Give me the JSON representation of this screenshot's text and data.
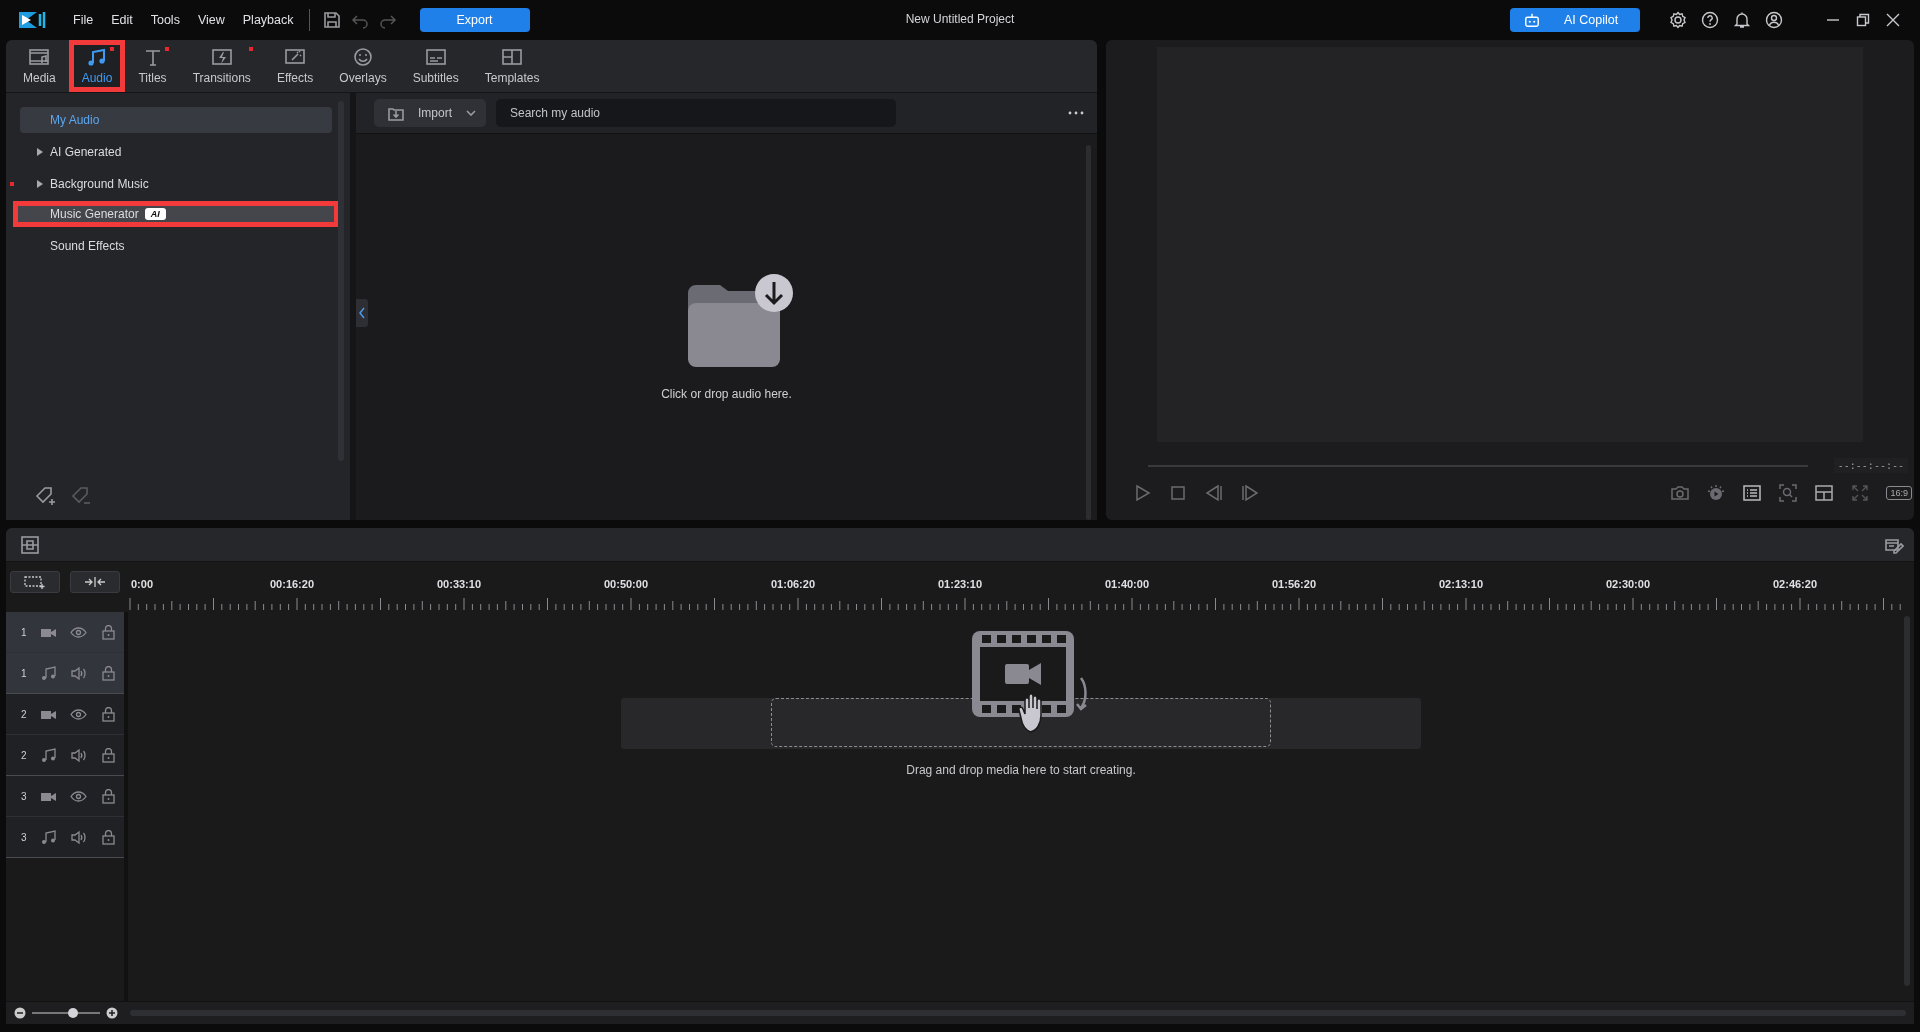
{
  "app": {
    "menu": [
      "File",
      "Edit",
      "Tools",
      "View",
      "Playback"
    ],
    "export": "Export",
    "title": "New Untitled Project",
    "copilot": "AI Copilot"
  },
  "library_tabs": [
    {
      "label": "Media",
      "selected": false,
      "new": false,
      "highlighted": false
    },
    {
      "label": "Audio",
      "selected": true,
      "new": true,
      "highlighted": true
    },
    {
      "label": "Titles",
      "selected": false,
      "new": true,
      "highlighted": false
    },
    {
      "label": "Transitions",
      "selected": false,
      "new": true,
      "highlighted": false
    },
    {
      "label": "Effects",
      "selected": false,
      "new": false,
      "highlighted": false
    },
    {
      "label": "Overlays",
      "selected": false,
      "new": false,
      "highlighted": false
    },
    {
      "label": "Subtitles",
      "selected": false,
      "new": false,
      "highlighted": false
    },
    {
      "label": "Templates",
      "selected": false,
      "new": false,
      "highlighted": false
    }
  ],
  "audio_tree": [
    {
      "label": "My Audio",
      "kind": "leaf",
      "selected": true,
      "new": false,
      "highlighted": false
    },
    {
      "label": "AI Generated",
      "kind": "folder",
      "expanded": false,
      "selected": false,
      "new": false,
      "highlighted": false
    },
    {
      "label": "Background Music",
      "kind": "folder",
      "expanded": false,
      "selected": false,
      "new": true,
      "highlighted": false
    },
    {
      "label": "Music Generator",
      "kind": "leaf",
      "badge": "AI",
      "selected": false,
      "new": false,
      "highlighted": true
    },
    {
      "label": "Sound Effects",
      "kind": "leaf",
      "selected": false,
      "new": false,
      "highlighted": false
    }
  ],
  "import_button": "Import",
  "search": {
    "placeholder": "Search my audio"
  },
  "empty_text": "Click or drop audio here.",
  "preview": {
    "timecode": "--:--:--:--",
    "aspect": "16:9"
  },
  "timeline": {
    "ruler": [
      "0:00",
      "00:16:20",
      "00:33:10",
      "00:50:00",
      "01:06:20",
      "01:23:10",
      "01:40:00",
      "01:56:20",
      "02:13:10",
      "02:30:00",
      "02:46:20"
    ],
    "tracks": [
      {
        "number": "1",
        "kind": "video",
        "selected": true
      },
      {
        "number": "1",
        "kind": "audio",
        "selected": true
      },
      {
        "number": "2",
        "kind": "video",
        "selected": false
      },
      {
        "number": "2",
        "kind": "audio",
        "selected": false
      },
      {
        "number": "3",
        "kind": "video",
        "selected": false
      },
      {
        "number": "3",
        "kind": "audio",
        "selected": false
      }
    ],
    "drop_hint": "Drag and drop media here to start creating.",
    "zoom": {
      "level": 0.6
    }
  }
}
